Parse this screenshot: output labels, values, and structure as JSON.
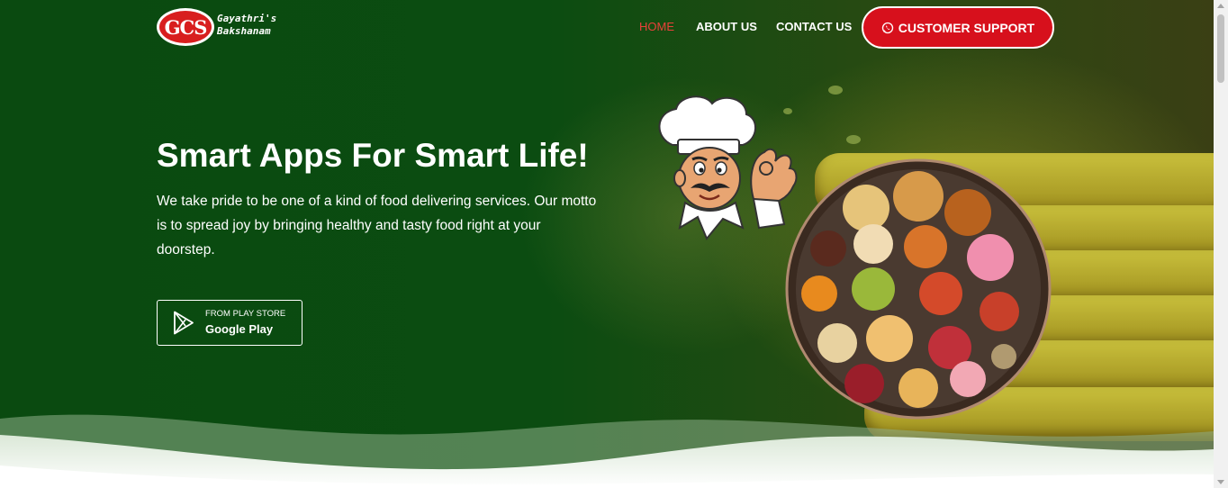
{
  "header": {
    "logo": {
      "badge": "GCS",
      "name_line1": "Gayathri's",
      "name_line2": "Bakshanam"
    },
    "nav": [
      {
        "label": "HOME",
        "active": true
      },
      {
        "label": "ABOUT US",
        "active": false
      },
      {
        "label": "CONTACT US",
        "active": false
      }
    ],
    "support_button": {
      "label": "CUSTOMER SUPPORT",
      "icon": "whatsapp-icon"
    }
  },
  "hero": {
    "headline": "Smart Apps For Smart Life!",
    "description": "We take pride to be one of a kind of food delivering services. Our motto is to spread joy by bringing healthy and tasty food right at your doorstep.",
    "store_button": {
      "small_label": "FROM PLAY STORE",
      "big_label": "Google Play",
      "icon": "google-play-icon"
    }
  },
  "colors": {
    "hero_background": "#0b4c11",
    "accent_red": "#d7101c",
    "active_nav": "#e8413a",
    "text": "#ffffff"
  }
}
